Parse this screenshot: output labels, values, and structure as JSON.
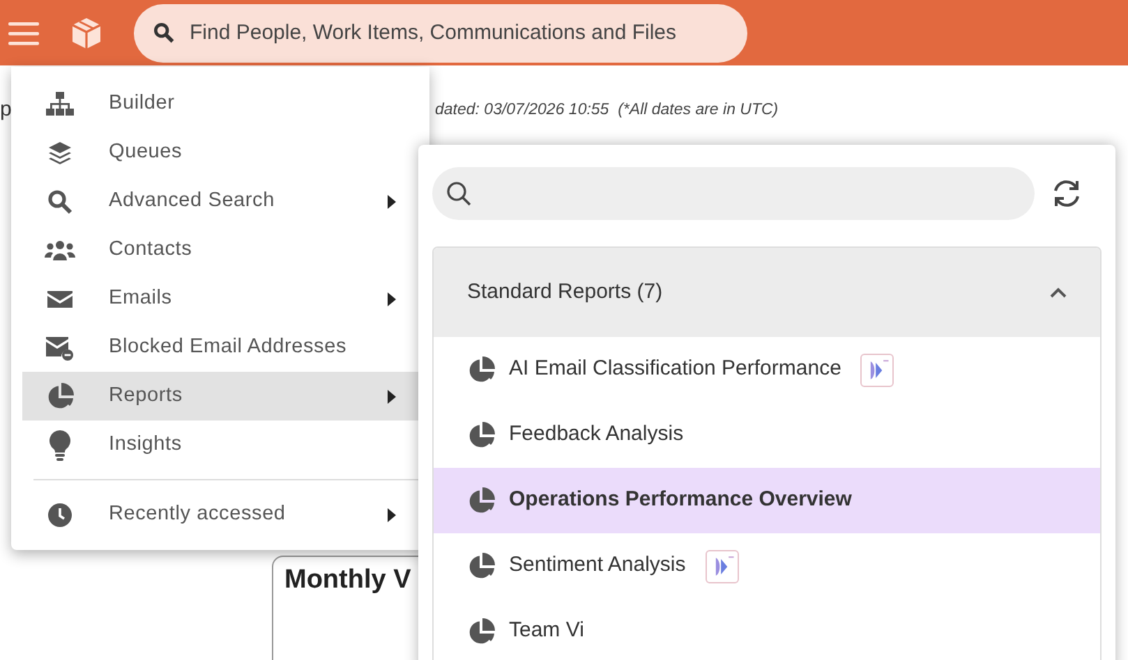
{
  "topbar": {
    "search": {
      "placeholder": "Find People, Work Items, Communications and Files"
    }
  },
  "page": {
    "title_fragment": "p",
    "updated": "dated: 03/07/2026 10:55  (*All dates are in UTC)",
    "card_title": "Monthly V"
  },
  "menu": {
    "items": [
      {
        "label": "Builder",
        "kind": "sitemap",
        "submenu": false,
        "selected": false
      },
      {
        "label": "Queues",
        "kind": "layers",
        "submenu": false,
        "selected": false
      },
      {
        "label": "Advanced Search",
        "kind": "search",
        "submenu": true,
        "selected": false
      },
      {
        "label": "Contacts",
        "kind": "people",
        "submenu": false,
        "selected": false
      },
      {
        "label": "Emails",
        "kind": "mail",
        "submenu": true,
        "selected": false
      },
      {
        "label": "Blocked Email Addresses",
        "kind": "mailblock",
        "submenu": false,
        "selected": false
      },
      {
        "label": "Reports",
        "kind": "pie",
        "submenu": true,
        "selected": true
      },
      {
        "label": "Insights",
        "kind": "bulb",
        "submenu": false,
        "selected": false
      }
    ],
    "footer_items": [
      {
        "label": "Recently accessed",
        "kind": "clock",
        "submenu": true,
        "selected": false
      }
    ]
  },
  "reports_panel": {
    "section": {
      "title": "Standard Reports (7)",
      "expanded": true,
      "items": [
        {
          "label": "AI Email Classification Performance",
          "ai": true,
          "selected": false
        },
        {
          "label": "Feedback Analysis",
          "ai": false,
          "selected": false
        },
        {
          "label": "Operations Performance Overview",
          "ai": false,
          "selected": true
        },
        {
          "label": "Sentiment Analysis",
          "ai": true,
          "selected": false
        },
        {
          "label": "Team Vi",
          "ai": false,
          "selected": false
        }
      ]
    }
  }
}
